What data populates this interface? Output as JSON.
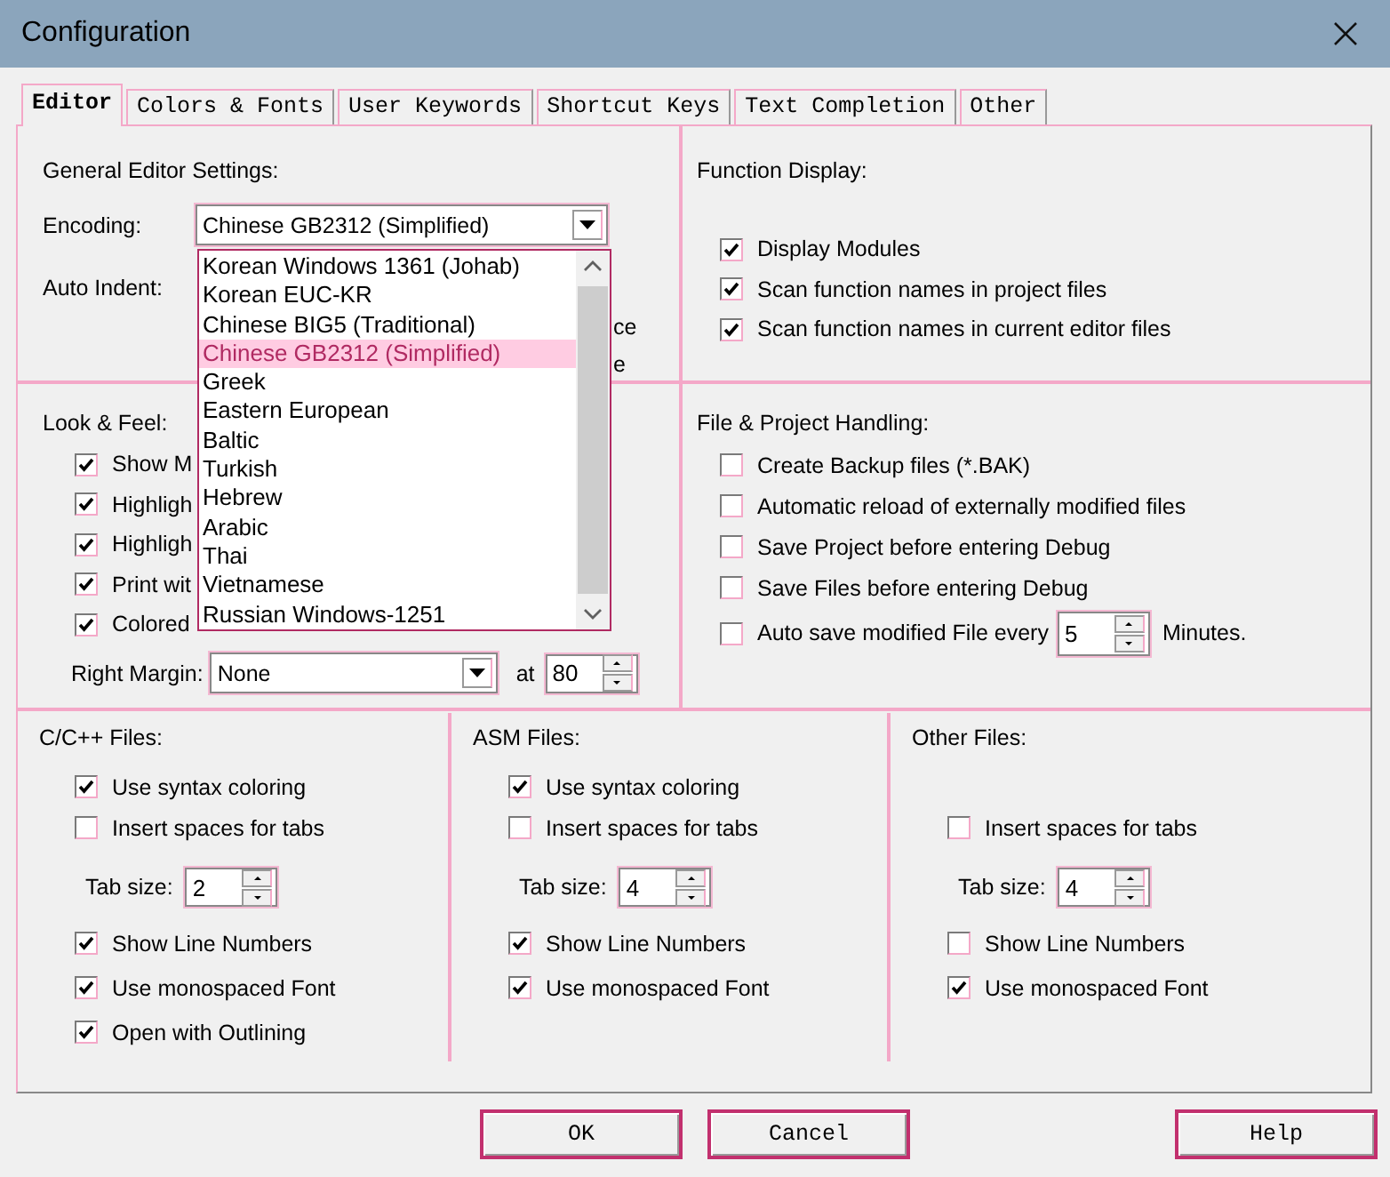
{
  "window": {
    "title": "Configuration"
  },
  "tabs": [
    {
      "label": "Editor",
      "selected": true
    },
    {
      "label": "Colors & Fonts",
      "selected": false
    },
    {
      "label": "User Keywords",
      "selected": false
    },
    {
      "label": "Shortcut Keys",
      "selected": false
    },
    {
      "label": "Text Completion",
      "selected": false
    },
    {
      "label": "Other",
      "selected": false
    }
  ],
  "general_editor_settings": {
    "heading": "General Editor Settings:",
    "encoding": {
      "label": "Encoding:",
      "value": "Chinese GB2312 (Simplified)",
      "expanded": true,
      "options": [
        {
          "label": "Korean Windows 1361 (Johab)",
          "selected": false
        },
        {
          "label": "Korean EUC-KR",
          "selected": false
        },
        {
          "label": "Chinese BIG5 (Traditional)",
          "selected": false
        },
        {
          "label": "Chinese GB2312 (Simplified)",
          "selected": true
        },
        {
          "label": "Greek",
          "selected": false
        },
        {
          "label": "Eastern European",
          "selected": false
        },
        {
          "label": "Baltic",
          "selected": false
        },
        {
          "label": "Turkish",
          "selected": false
        },
        {
          "label": "Hebrew",
          "selected": false
        },
        {
          "label": "Arabic",
          "selected": false
        },
        {
          "label": "Thai",
          "selected": false
        },
        {
          "label": "Vietnamese",
          "selected": false
        },
        {
          "label": "Russian Windows-1251",
          "selected": false
        }
      ]
    },
    "auto_indent": {
      "label": "Auto Indent:"
    },
    "covered_texts": [
      "ce",
      "e"
    ]
  },
  "look_and_feel": {
    "heading": "Look & Feel:",
    "options": [
      {
        "label": "Show M",
        "checked": true
      },
      {
        "label": "Highligh",
        "checked": true
      },
      {
        "label": "Highligh",
        "checked": true
      },
      {
        "label": "Print wit",
        "checked": true
      },
      {
        "label": "Colored",
        "checked": true
      }
    ],
    "right_margin": {
      "label": "Right Margin:",
      "value": "None"
    },
    "at": {
      "label": "at",
      "value": "80"
    }
  },
  "function_display": {
    "heading": "Function Display:",
    "options": [
      {
        "label": "Display Modules",
        "checked": true
      },
      {
        "label": "Scan function names in project files",
        "checked": true
      },
      {
        "label": "Scan function names in current editor files",
        "checked": true
      }
    ]
  },
  "file_project_handling": {
    "heading": "File & Project Handling:",
    "options": [
      {
        "label": "Create Backup files (*.BAK)",
        "checked": false
      },
      {
        "label": "Automatic reload of externally modified files",
        "checked": false
      },
      {
        "label": "Save Project before entering Debug",
        "checked": false
      },
      {
        "label": "Save Files before entering Debug",
        "checked": false
      }
    ],
    "autosave": {
      "label": "Auto save modified File every",
      "checked": false,
      "value": "5",
      "unit": "Minutes."
    }
  },
  "file_types": [
    {
      "heading": "C/C++ Files:",
      "options": [
        {
          "kind": "checkbox",
          "label": "Use syntax coloring",
          "checked": true
        },
        {
          "kind": "checkbox",
          "label": "Insert spaces for tabs",
          "checked": false
        },
        {
          "kind": "tab_size",
          "label": "Tab size:",
          "value": "2"
        },
        {
          "kind": "checkbox",
          "label": "Show Line Numbers",
          "checked": true
        },
        {
          "kind": "checkbox",
          "label": "Use monospaced Font",
          "checked": true
        },
        {
          "kind": "checkbox",
          "label": "Open with Outlining",
          "checked": true
        }
      ]
    },
    {
      "heading": "ASM Files:",
      "options": [
        {
          "kind": "checkbox",
          "label": "Use syntax coloring",
          "checked": true
        },
        {
          "kind": "checkbox",
          "label": "Insert spaces for tabs",
          "checked": false
        },
        {
          "kind": "tab_size",
          "label": "Tab size:",
          "value": "4"
        },
        {
          "kind": "checkbox",
          "label": "Show Line Numbers",
          "checked": true
        },
        {
          "kind": "checkbox",
          "label": "Use monospaced Font",
          "checked": true
        }
      ]
    },
    {
      "heading": "Other Files:",
      "options": [
        {
          "kind": "checkbox",
          "label": "Insert spaces for tabs",
          "checked": false
        },
        {
          "kind": "tab_size",
          "label": "Tab size:",
          "value": "4"
        },
        {
          "kind": "checkbox",
          "label": "Show Line Numbers",
          "checked": false
        },
        {
          "kind": "checkbox",
          "label": "Use monospaced Font",
          "checked": true
        }
      ]
    }
  ],
  "buttons": [
    {
      "label": "OK"
    },
    {
      "label": "Cancel"
    },
    {
      "label": "Help"
    }
  ]
}
